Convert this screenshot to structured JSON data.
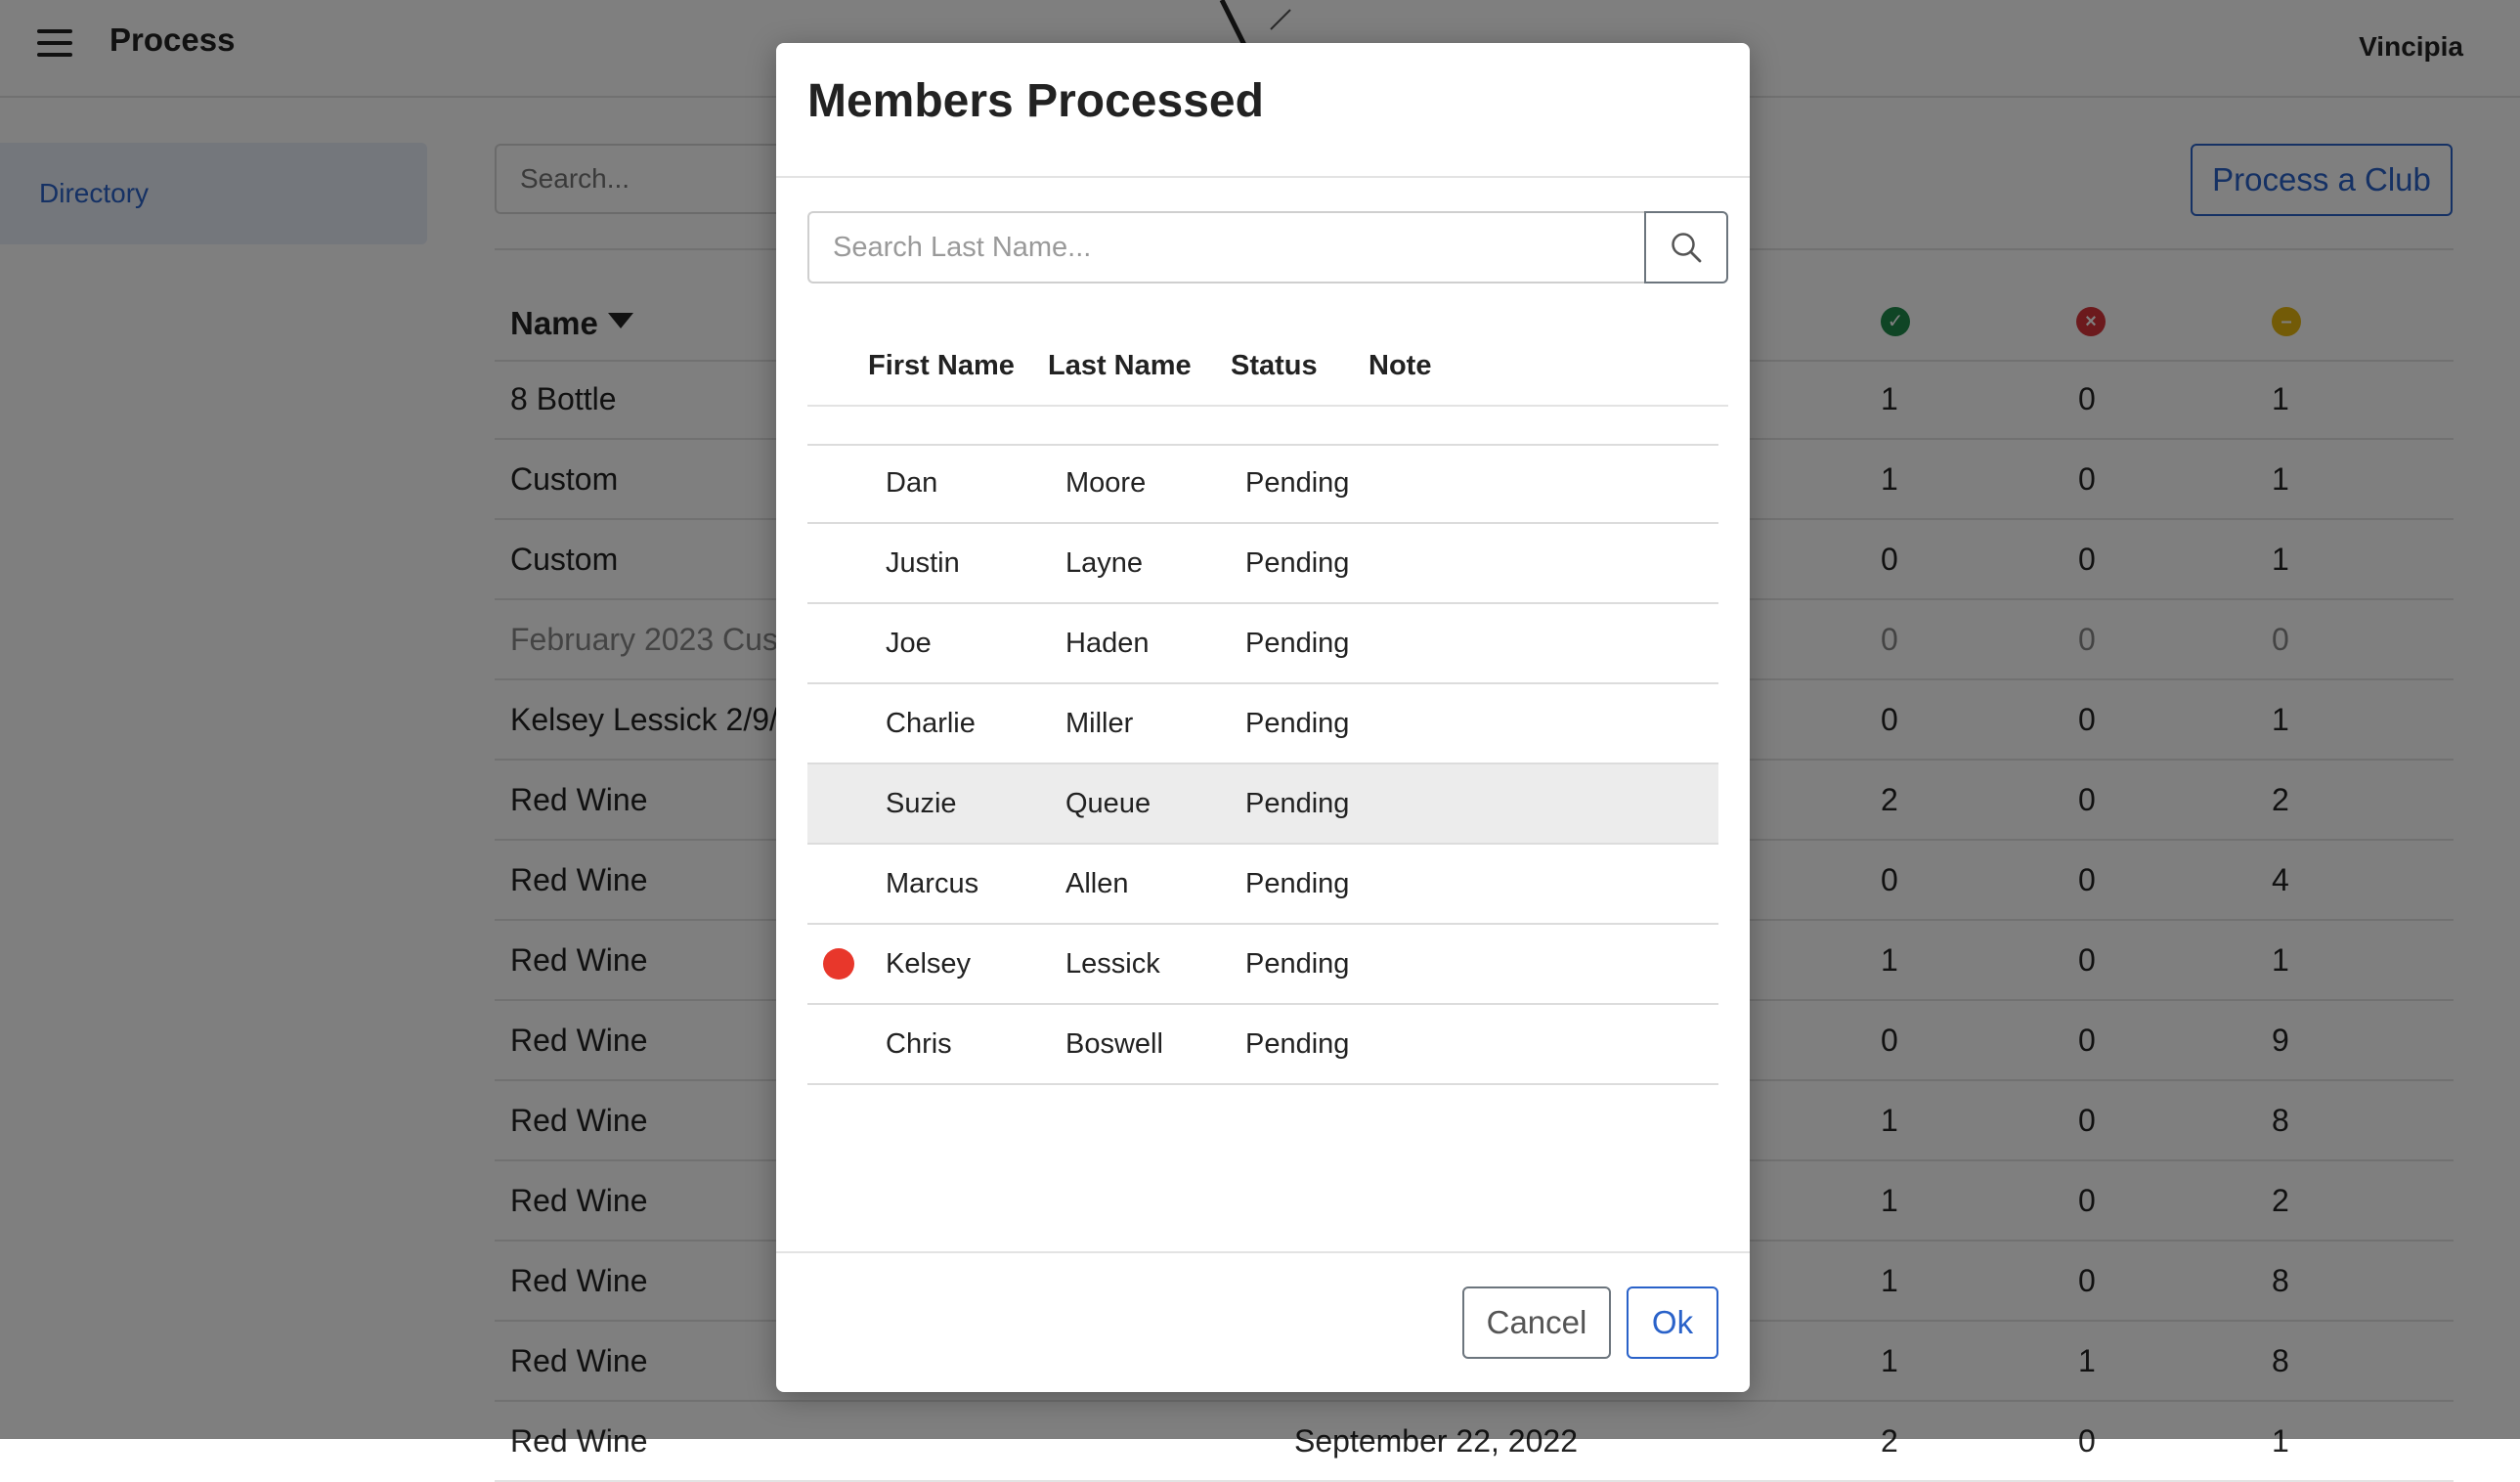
{
  "app": {
    "title": "Process",
    "user": "Vincipia",
    "menu_icon": "hamburger-menu-icon",
    "logo_icon": "brand-logo-icon"
  },
  "sidebar": {
    "items": [
      {
        "label": "Directory",
        "active": true
      }
    ]
  },
  "toolbar": {
    "search_placeholder": "Search...",
    "process_button": "Process a Club"
  },
  "table": {
    "name_header": "Name",
    "sort_icon": "sort-desc-icon",
    "status_icons": [
      "check-circle-icon",
      "x-circle-icon",
      "minus-circle-icon"
    ],
    "status_colors": {
      "success": "#1e8a4b",
      "failed": "#d9343a",
      "pending": "#e7b60f"
    },
    "rows": [
      {
        "name": "8 Bottle",
        "date": "",
        "ok": "1",
        "fail": "0",
        "pending": "1"
      },
      {
        "name": "Custom",
        "date": "",
        "ok": "1",
        "fail": "0",
        "pending": "1"
      },
      {
        "name": "Custom",
        "date": "",
        "ok": "0",
        "fail": "0",
        "pending": "1"
      },
      {
        "name": "February 2023 Cus",
        "date": "",
        "ok": "0",
        "fail": "0",
        "pending": "0"
      },
      {
        "name": "Kelsey Lessick 2/9/",
        "date": "",
        "ok": "0",
        "fail": "0",
        "pending": "1"
      },
      {
        "name": "Red Wine",
        "date": "",
        "ok": "2",
        "fail": "0",
        "pending": "2"
      },
      {
        "name": "Red Wine",
        "date": "",
        "ok": "0",
        "fail": "0",
        "pending": "4"
      },
      {
        "name": "Red Wine",
        "date": "",
        "ok": "1",
        "fail": "0",
        "pending": "1"
      },
      {
        "name": "Red Wine",
        "date": "",
        "ok": "0",
        "fail": "0",
        "pending": "9"
      },
      {
        "name": "Red Wine",
        "date": "",
        "ok": "1",
        "fail": "0",
        "pending": "8"
      },
      {
        "name": "Red Wine",
        "date": "",
        "ok": "1",
        "fail": "0",
        "pending": "2"
      },
      {
        "name": "Red Wine",
        "date": "",
        "ok": "1",
        "fail": "0",
        "pending": "8"
      },
      {
        "name": "Red Wine",
        "date": "",
        "ok": "1",
        "fail": "1",
        "pending": "8"
      },
      {
        "name": "Red Wine",
        "date": "September 22, 2022",
        "ok": "2",
        "fail": "0",
        "pending": "1"
      }
    ]
  },
  "modal": {
    "title": "Members Processed",
    "search_placeholder": "Search Last Name...",
    "search_icon": "search-icon",
    "columns": {
      "first": "First Name",
      "last": "Last Name",
      "status": "Status",
      "note": "Note"
    },
    "rows": [
      {
        "first": "Dan",
        "last": "Moore",
        "status": "Pending",
        "flag": false,
        "highlight": false
      },
      {
        "first": "Justin",
        "last": "Layne",
        "status": "Pending",
        "flag": false,
        "highlight": false
      },
      {
        "first": "Joe",
        "last": "Haden",
        "status": "Pending",
        "flag": false,
        "highlight": false
      },
      {
        "first": "Charlie",
        "last": "Miller",
        "status": "Pending",
        "flag": false,
        "highlight": false
      },
      {
        "first": "Suzie",
        "last": "Queue",
        "status": "Pending",
        "flag": false,
        "highlight": true
      },
      {
        "first": "Marcus",
        "last": "Allen",
        "status": "Pending",
        "flag": false,
        "highlight": false
      },
      {
        "first": "Kelsey",
        "last": "Lessick",
        "status": "Pending",
        "flag": true,
        "highlight": false
      },
      {
        "first": "Chris",
        "last": "Boswell",
        "status": "Pending",
        "flag": false,
        "highlight": false
      }
    ],
    "flag_color": "#e8372b",
    "cancel_label": "Cancel",
    "ok_label": "Ok"
  }
}
